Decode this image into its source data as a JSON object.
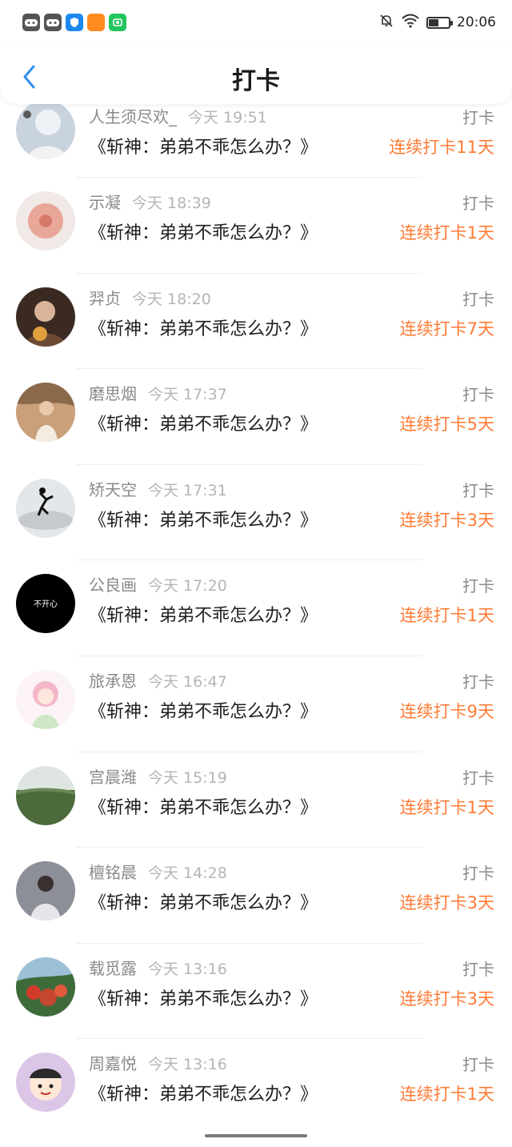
{
  "status": {
    "time": "20:06"
  },
  "header": {
    "title": "打卡"
  },
  "entries": [
    {
      "name": "人生须尽欢_",
      "time": "今天 19:51",
      "book": "《斩神：弟弟不乖怎么办？》",
      "tag": "打卡",
      "streak": "连续打卡11天",
      "avatar_color": "#c9d3de"
    },
    {
      "name": "示凝",
      "time": "今天 18:39",
      "book": "《斩神：弟弟不乖怎么办？》",
      "tag": "打卡",
      "streak": "连续打卡1天",
      "avatar_color": "#e9a79a"
    },
    {
      "name": "羿贞",
      "time": "今天 18:20",
      "book": "《斩神：弟弟不乖怎么办？》",
      "tag": "打卡",
      "streak": "连续打卡7天",
      "avatar_color": "#5a3a2a"
    },
    {
      "name": "磨思烟",
      "time": "今天 17:37",
      "book": "《斩神：弟弟不乖怎么办？》",
      "tag": "打卡",
      "streak": "连续打卡5天",
      "avatar_color": "#c9a07a"
    },
    {
      "name": "矫天空",
      "time": "今天 17:31",
      "book": "《斩神：弟弟不乖怎么办？》",
      "tag": "打卡",
      "streak": "连续打卡3天",
      "avatar_color": "#d4d8dc"
    },
    {
      "name": "公良画",
      "time": "今天 17:20",
      "book": "《斩神：弟弟不乖怎么办？》",
      "tag": "打卡",
      "streak": "连续打卡1天",
      "avatar_color": "#000000",
      "avatar_text": "不开心"
    },
    {
      "name": "旅承恩",
      "time": "今天 16:47",
      "book": "《斩神：弟弟不乖怎么办？》",
      "tag": "打卡",
      "streak": "连续打卡9天",
      "avatar_color": "#f3dbe3"
    },
    {
      "name": "宫晨潍",
      "time": "今天 15:19",
      "book": "《斩神：弟弟不乖怎么办？》",
      "tag": "打卡",
      "streak": "连续打卡1天",
      "avatar_color": "#4d6a3c"
    },
    {
      "name": "檀铭晨",
      "time": "今天 14:28",
      "book": "《斩神：弟弟不乖怎么办？》",
      "tag": "打卡",
      "streak": "连续打卡3天",
      "avatar_color": "#8d8f98"
    },
    {
      "name": "载觅露",
      "time": "今天 13:16",
      "book": "《斩神：弟弟不乖怎么办？》",
      "tag": "打卡",
      "streak": "连续打卡3天",
      "avatar_color": "#c4462e"
    },
    {
      "name": "周嘉悦",
      "time": "今天 13:16",
      "book": "《斩神：弟弟不乖怎么办？》",
      "tag": "打卡",
      "streak": "连续打卡1天",
      "avatar_color": "#dcc6e8"
    }
  ],
  "colors": {
    "accent": "#ff7b35",
    "back": "#2f8ff0"
  }
}
